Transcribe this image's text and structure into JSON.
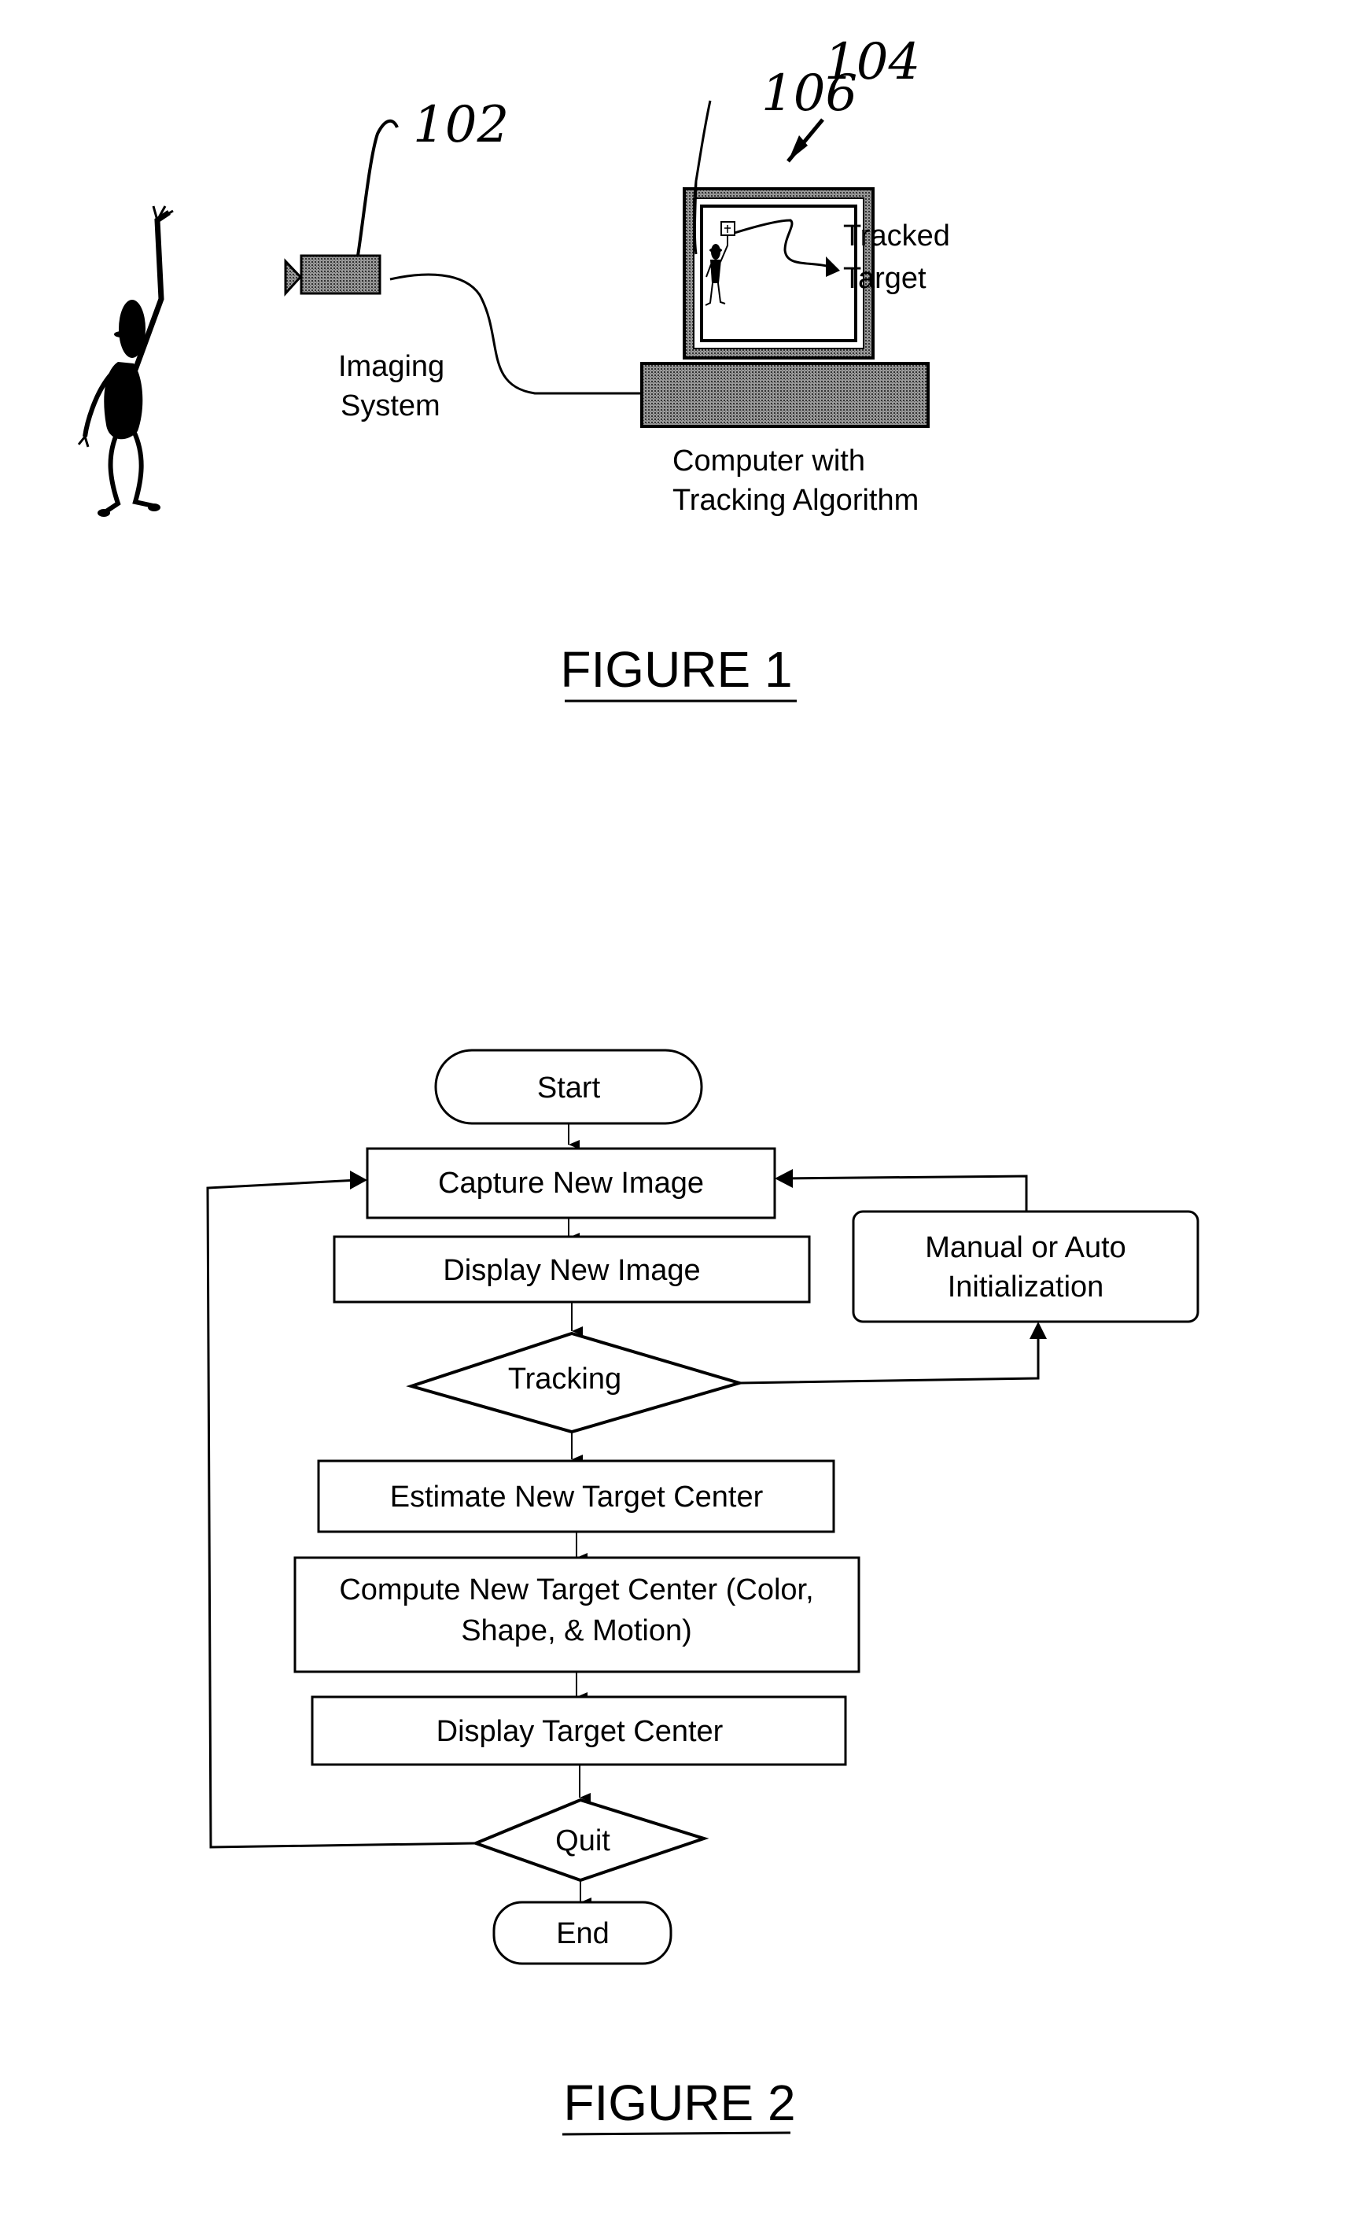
{
  "figure1": {
    "caption": "FIGURE 1",
    "imaging_system_label": [
      "Imaging",
      "System"
    ],
    "computer_label": [
      "Computer with",
      "Tracking Algorithm"
    ],
    "tracked_target_label": [
      "Tracked",
      "Target"
    ],
    "ref_camera": "102",
    "ref_computer": "104",
    "ref_display": "106"
  },
  "figure2": {
    "caption": "FIGURE 2",
    "nodes": {
      "start": "Start",
      "capture": "Capture New Image",
      "display_image": "Display New Image",
      "manual_init": [
        "Manual or Auto",
        "Initialization"
      ],
      "tracking": "Tracking",
      "estimate": "Estimate New Target Center",
      "compute": [
        "Compute New Target Center (Color,",
        "Shape, & Motion)"
      ],
      "display_target": "Display Target Center",
      "quit": "Quit",
      "end": "End"
    }
  },
  "colors": {
    "ink": "#000000",
    "paper": "#ffffff",
    "halftone": "#7a7a7a"
  }
}
